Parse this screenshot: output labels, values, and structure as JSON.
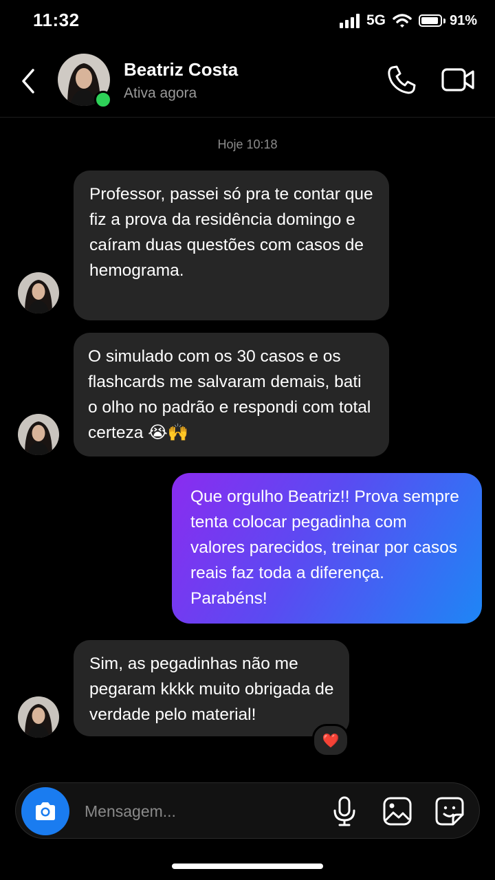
{
  "status_bar": {
    "time": "11:32",
    "network": "5G",
    "battery": "91%",
    "battery_level": 0.91
  },
  "header": {
    "name": "Beatriz Costa",
    "status": "Ativa agora",
    "back_icon": "chevron-left-icon",
    "call_icon": "phone-icon",
    "video_icon": "video-camera-icon"
  },
  "timestamp": "Hoje 10:18",
  "messages": [
    {
      "direction": "incoming",
      "text": "Professor, passei só pra te contar que fiz a prova da residência domingo e caíram duas questões com casos de hemograma."
    },
    {
      "direction": "incoming",
      "text": "O simulado com os 30 casos e os flashcards me salvaram demais, bati o olho no padrão e respondi com total certeza 😭🙌"
    },
    {
      "direction": "outgoing",
      "text": "Que orgulho Beatriz!! Prova sempre tenta colocar pegadinha com valores parecidos, treinar por casos reais faz toda a diferença. Parabéns!"
    },
    {
      "direction": "incoming",
      "text": "Sim, as pegadinhas não me pegaram kkkk muito obrigada de verdade pelo material!",
      "reaction": "❤️"
    }
  ],
  "composer": {
    "placeholder": "Mensagem...",
    "camera_icon": "camera-icon",
    "mic_icon": "microphone-icon",
    "gallery_icon": "image-icon",
    "sticker_icon": "sticker-icon"
  },
  "colors": {
    "background": "#000000",
    "incoming_bubble": "#262626",
    "outgoing_gradient_start": "#8a2cf0",
    "outgoing_gradient_end": "#1e86f5",
    "camera_button": "#1a7cf0",
    "online_dot": "#2ed158"
  }
}
